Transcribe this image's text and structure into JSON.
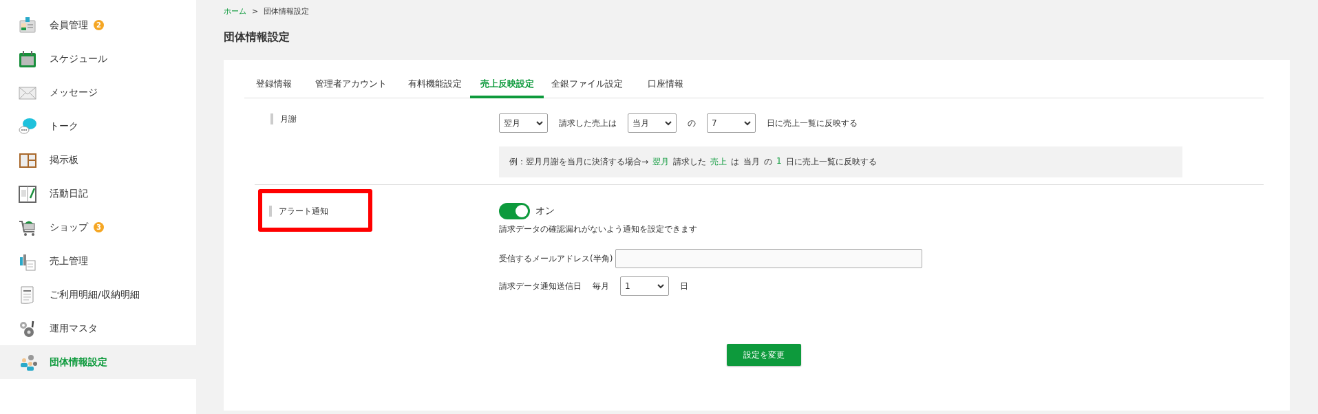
{
  "sidebar": {
    "items": [
      {
        "label": "会員管理",
        "badge": "2",
        "selected": false
      },
      {
        "label": "スケジュール",
        "selected": false
      },
      {
        "label": "メッセージ",
        "selected": false
      },
      {
        "label": "トーク",
        "selected": false
      },
      {
        "label": "掲示板",
        "selected": false
      },
      {
        "label": "活動日記",
        "selected": false
      },
      {
        "label": "ショップ",
        "badge": "3",
        "selected": false
      },
      {
        "label": "売上管理",
        "selected": false
      },
      {
        "label": "ご利用明細/収納明細",
        "selected": false
      },
      {
        "label": "運用マスタ",
        "selected": false
      },
      {
        "label": "団体情報設定",
        "selected": true
      }
    ]
  },
  "breadcrumb": [
    {
      "label": "ホーム",
      "link": true
    },
    {
      "label": ">",
      "link": false
    },
    {
      "label": "団体情報設定",
      "link": false
    }
  ],
  "page_title": "団体情報設定",
  "tabs": [
    {
      "label": "登録情報",
      "selected": false
    },
    {
      "label": "管理者アカウント",
      "selected": false
    },
    {
      "label": "有料機能設定",
      "selected": false
    },
    {
      "label": "売上反映設定",
      "selected": true
    },
    {
      "label": "全銀ファイル設定",
      "selected": false
    },
    {
      "label": "口座情報",
      "selected": false
    }
  ],
  "sections": [
    {
      "label": "月謝",
      "highlighted": false,
      "rows": [
        {
          "kind": "inline",
          "parts": [
            {
              "kind": "select",
              "value": "翌月"
            },
            {
              "kind": "text",
              "text": "請求した売上は"
            },
            {
              "kind": "select",
              "value": "当月"
            },
            {
              "kind": "text",
              "text": "の"
            },
            {
              "kind": "select",
              "value": "7"
            },
            {
              "kind": "text",
              "text": "日に売上一覧に反映する"
            }
          ]
        },
        {
          "kind": "example",
          "segments": [
            {
              "text": "例：翌月月謝を当月に決済する場合→",
              "accent": false
            },
            {
              "text": "翌月",
              "accent": true
            },
            {
              "text": "請求した",
              "accent": false
            },
            {
              "text": "売上",
              "accent": true
            },
            {
              "text": "は",
              "accent": false
            },
            {
              "text": "当月",
              "accent": false
            },
            {
              "text": "の",
              "accent": false
            },
            {
              "text": "1",
              "accent": true
            },
            {
              "text": "日に売上一覧に反映する",
              "accent": false
            }
          ]
        }
      ]
    },
    {
      "label": "アラート通知",
      "highlighted": true,
      "rows": [
        {
          "kind": "toggle",
          "on": true,
          "text": "オン"
        },
        {
          "kind": "note",
          "text": "請求データの確認漏れがないよう通知を設定できます"
        },
        {
          "kind": "inline",
          "parts": [
            {
              "kind": "text",
              "text": "受信するメールアドレス(半角)"
            },
            {
              "kind": "input"
            }
          ]
        },
        {
          "kind": "inline",
          "parts": [
            {
              "kind": "text",
              "text": "請求データ通知送信日"
            },
            {
              "kind": "text",
              "text": "毎月"
            },
            {
              "kind": "select",
              "value": "1"
            },
            {
              "kind": "text",
              "text": "日"
            }
          ]
        }
      ]
    }
  ],
  "submit": "設定を変更"
}
